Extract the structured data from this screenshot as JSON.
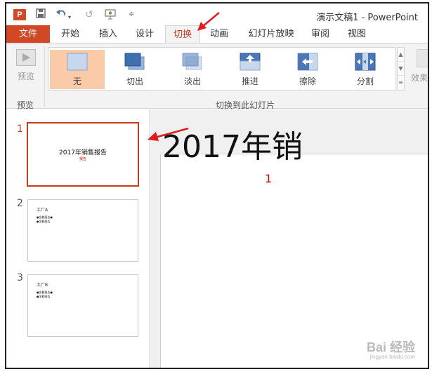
{
  "window": {
    "title": "演示文稿1 - PowerPoint"
  },
  "quick_access": {
    "logo": "P",
    "save_icon": "save-icon",
    "undo_icon": "undo-icon",
    "redo_icon": "redo-icon",
    "present_icon": "present-icon",
    "more_icon": "customize-icon"
  },
  "tabs": [
    {
      "label": "文件"
    },
    {
      "label": "开始"
    },
    {
      "label": "插入"
    },
    {
      "label": "设计"
    },
    {
      "label": "切换"
    },
    {
      "label": "动画"
    },
    {
      "label": "幻灯片放映"
    },
    {
      "label": "审阅"
    },
    {
      "label": "视图"
    }
  ],
  "ribbon": {
    "preview_label": "预览",
    "preview_group": "预览",
    "transitions_group": "切换到此幻灯片",
    "effects_label": "效果",
    "transitions": [
      {
        "label": "无"
      },
      {
        "label": "切出"
      },
      {
        "label": "淡出"
      },
      {
        "label": "推进"
      },
      {
        "label": "擦除"
      },
      {
        "label": "分割"
      }
    ],
    "selected_transition": "无"
  },
  "slides": [
    {
      "number": "1",
      "title": "2017年销售报告",
      "subtitle": "报告"
    },
    {
      "number": "2",
      "title": "工厂A",
      "bullets": [
        "●金额报告●",
        "●金额报告"
      ]
    },
    {
      "number": "3",
      "title": "工厂B",
      "bullets": [
        "●金额报告●",
        "●金额报告"
      ]
    }
  ],
  "editor": {
    "title_visible": "2017年销",
    "subtitle_visible": "1"
  },
  "watermark": {
    "brand": "Bai 经验",
    "url": "jingyan.baidu.com"
  },
  "colors": {
    "accent": "#d24726",
    "active_tab_text": "#c43e1c",
    "selected_tile": "#fbcaa8",
    "arrow": "#e21b1b"
  }
}
